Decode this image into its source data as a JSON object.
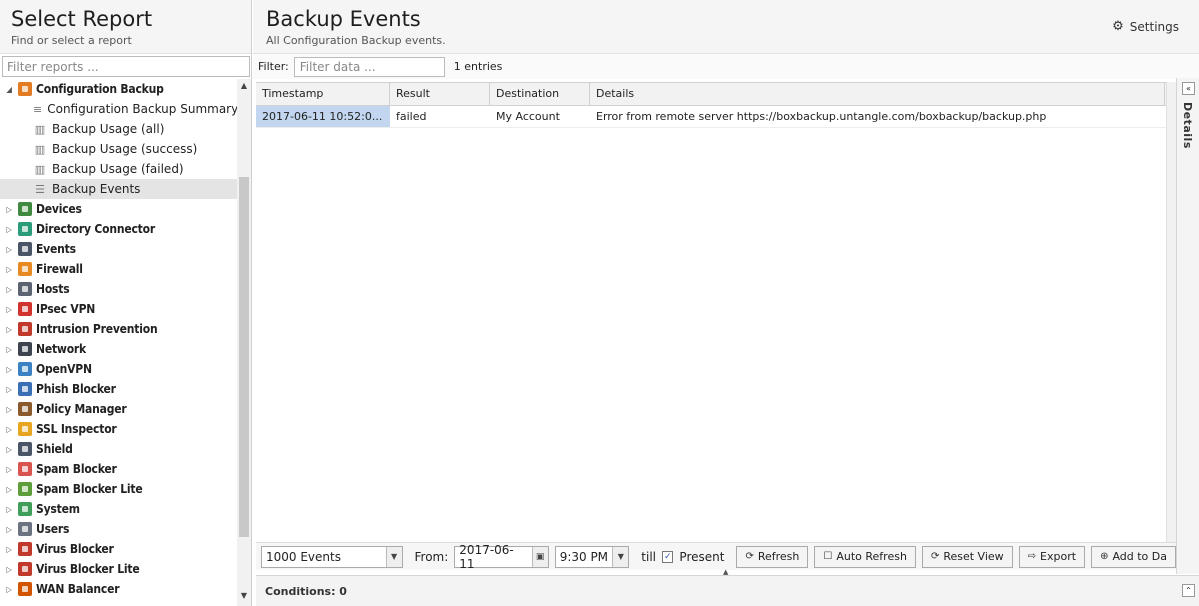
{
  "left": {
    "title": "Select Report",
    "subtitle": "Find or select a report",
    "filter_placeholder": "Filter reports ...",
    "tree": [
      {
        "kind": "cat",
        "label": "Configuration Backup",
        "expanded": true,
        "color": "#e37b22"
      },
      {
        "kind": "child",
        "label": "Configuration Backup Summary",
        "icon": "≡"
      },
      {
        "kind": "child",
        "label": "Backup Usage (all)",
        "icon": "▥"
      },
      {
        "kind": "child",
        "label": "Backup Usage (success)",
        "icon": "▥"
      },
      {
        "kind": "child",
        "label": "Backup Usage (failed)",
        "icon": "▥"
      },
      {
        "kind": "child",
        "label": "Backup Events",
        "icon": "☰",
        "selected": true
      },
      {
        "kind": "cat",
        "label": "Devices",
        "color": "#3f8a3f"
      },
      {
        "kind": "cat",
        "label": "Directory Connector",
        "color": "#2a9c7a"
      },
      {
        "kind": "cat",
        "label": "Events",
        "color": "#4a5568"
      },
      {
        "kind": "cat",
        "label": "Firewall",
        "color": "#e88a22"
      },
      {
        "kind": "cat",
        "label": "Hosts",
        "color": "#5b6270"
      },
      {
        "kind": "cat",
        "label": "IPsec VPN",
        "color": "#d0342c"
      },
      {
        "kind": "cat",
        "label": "Intrusion Prevention",
        "color": "#c0392b"
      },
      {
        "kind": "cat",
        "label": "Network",
        "color": "#3d4450"
      },
      {
        "kind": "cat",
        "label": "OpenVPN",
        "color": "#3b82c4"
      },
      {
        "kind": "cat",
        "label": "Phish Blocker",
        "color": "#3b6fb5"
      },
      {
        "kind": "cat",
        "label": "Policy Manager",
        "color": "#8a5a2b"
      },
      {
        "kind": "cat",
        "label": "SSL Inspector",
        "color": "#e8a620"
      },
      {
        "kind": "cat",
        "label": "Shield",
        "color": "#4a5568"
      },
      {
        "kind": "cat",
        "label": "Spam Blocker",
        "color": "#d9534f"
      },
      {
        "kind": "cat",
        "label": "Spam Blocker Lite",
        "color": "#5c9e3a"
      },
      {
        "kind": "cat",
        "label": "System",
        "color": "#3e9e5a"
      },
      {
        "kind": "cat",
        "label": "Users",
        "color": "#6b7280"
      },
      {
        "kind": "cat",
        "label": "Virus Blocker",
        "color": "#c0392b"
      },
      {
        "kind": "cat",
        "label": "Virus Blocker Lite",
        "color": "#c0392b"
      },
      {
        "kind": "cat",
        "label": "WAN Balancer",
        "color": "#d35400"
      }
    ]
  },
  "right": {
    "title": "Backup Events",
    "subtitle": "All Configuration Backup events.",
    "settings_label": "Settings",
    "filter_label": "Filter:",
    "filter_placeholder": "Filter data ...",
    "entries": "1 entries",
    "details_label": "Details"
  },
  "grid": {
    "columns": [
      "Timestamp",
      "Result",
      "Destination",
      "Details"
    ],
    "rows": [
      [
        "2017-06-11 10:52:0...",
        "failed",
        "My Account",
        "Error from remote server https://boxbackup.untangle.com/boxbackup/backup.php"
      ]
    ]
  },
  "bottom": {
    "events_value": "1000 Events",
    "from_label": "From:",
    "from_date": "2017-06-11",
    "from_time": "9:30 PM",
    "till_label": "till",
    "present_label": "Present",
    "refresh_label": "Refresh",
    "auto_refresh_label": "Auto Refresh",
    "reset_view_label": "Reset View",
    "export_label": "Export",
    "add_label": "Add to Da"
  },
  "conditions": {
    "label": "Conditions: 0"
  }
}
